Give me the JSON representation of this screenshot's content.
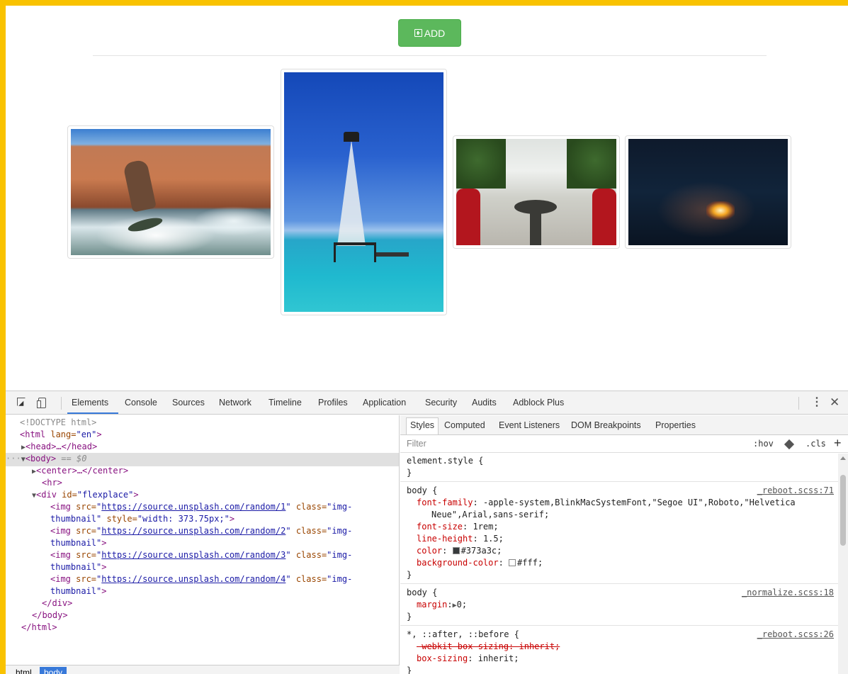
{
  "page": {
    "add_button_label": "ADD"
  },
  "devtools": {
    "tabs": [
      "Elements",
      "Console",
      "Sources",
      "Network",
      "Timeline",
      "Profiles",
      "Application",
      "Security",
      "Audits",
      "Adblock Plus"
    ],
    "active_tab": "Elements",
    "dom": {
      "doctype": "<!DOCTYPE html>",
      "html_open_tag": "<html",
      "html_lang_attr": " lang=",
      "html_lang_val": "\"en\"",
      "html_open_close": ">",
      "head": "<head>…</head>",
      "body_tag": "<body>",
      "body_marker": " == $0",
      "center": "<center>…</center>",
      "hr": "<hr>",
      "div_open_tag": "<div",
      "div_id_attr": " id=",
      "div_id_val": "\"flexplace\"",
      "div_open_close": ">",
      "img_tag": "<img",
      "src_attr": " src=",
      "class_attr": " class=",
      "quote": "\"",
      "class_val_head": "\"img-",
      "class_val_tail": "thumbnail\"",
      "style_attr": " style=",
      "style_val": "\"width: 373.75px;\"",
      "tag_close": ">",
      "images": [
        {
          "src": "https://source.unsplash.com/random/1"
        },
        {
          "src": "https://source.unsplash.com/random/2"
        },
        {
          "src": "https://source.unsplash.com/random/3"
        },
        {
          "src": "https://source.unsplash.com/random/4"
        }
      ],
      "div_close": "</div>",
      "body_close": "</body>",
      "html_close": "</html>"
    },
    "breadcrumbs": [
      "html",
      "body"
    ],
    "styles_tabs": [
      "Styles",
      "Computed",
      "Event Listeners",
      "DOM Breakpoints",
      "Properties"
    ],
    "filter_placeholder": "Filter",
    "hov_label": ":hov",
    "cls_label": ".cls",
    "plus_label": "+",
    "rules": {
      "element_style": "element.style {",
      "close_brace": "}",
      "body_selector": "body {",
      "reboot_src": "_reboot.scss:71",
      "font_family_prop": "font-family",
      "font_family_val_1": "-apple-system,BlinkMacSystemFont,\"Segoe UI\",Roboto,\"Helvetica",
      "font_family_val_2": "Neue\",Arial,sans-serif;",
      "font_size_prop": "font-size",
      "font_size_val": "1rem;",
      "line_height_prop": "line-height",
      "line_height_val": "1.5;",
      "color_prop": "color",
      "color_val": "#373a3c;",
      "color_swatch": "#373a3c",
      "bg_prop": "background-color",
      "bg_val": "#fff;",
      "bg_swatch": "#ffffff",
      "body2_selector": "body {",
      "normalize_src": "_normalize.scss:18",
      "margin_prop": "margin",
      "margin_val": "0;",
      "universal_selector": "*, ::after, ::before {",
      "reboot26_src": "_reboot.scss:26",
      "webkit_line": "-webkit-box-sizing: inherit;",
      "box_sizing_prop": "box-sizing",
      "box_sizing_val": "inherit;",
      "colon": ": ",
      "colon_tight": ":"
    }
  }
}
